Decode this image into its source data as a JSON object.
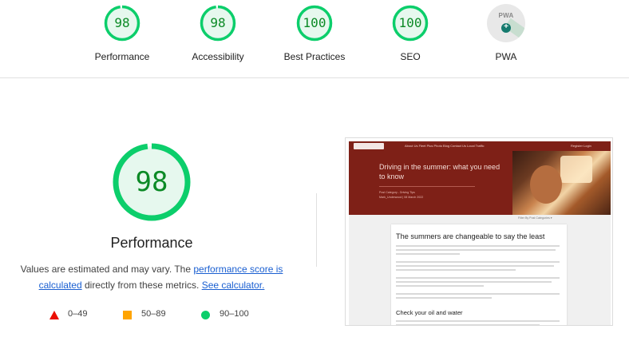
{
  "gauges": [
    {
      "label": "Performance",
      "score": "98",
      "fraction": 0.98
    },
    {
      "label": "Accessibility",
      "score": "98",
      "fraction": 0.98
    },
    {
      "label": "Best Practices",
      "score": "100",
      "fraction": 1.0
    },
    {
      "label": "SEO",
      "score": "100",
      "fraction": 1.0
    }
  ],
  "pwa": {
    "label": "PWA",
    "badge_text": "PWA",
    "icon": "pwa-badge-icon"
  },
  "performance": {
    "score": "98",
    "fraction": 0.98,
    "title": "Performance",
    "desc_prefix": "Values are estimated and may vary. The ",
    "desc_link1": "performance score is calculated",
    "desc_middle": " directly from these metrics. ",
    "desc_link2": "See calculator."
  },
  "legend": [
    {
      "shape": "triangle",
      "range": "0–49",
      "color": "#eb0f00"
    },
    {
      "shape": "square",
      "range": "50–89",
      "color": "#ffa400"
    },
    {
      "shape": "circle",
      "range": "90–100",
      "color": "#0cce6b"
    }
  ],
  "colors": {
    "pass_green": "#0c8a26",
    "pass_ring": "#0cce6b",
    "pass_fill": "#e6f8ee",
    "site_brand": "#7e2017"
  },
  "thumbnail": {
    "nav_links": "About Us    Fleet Plus    Photo    Blog    Contact Us    Local Traffic",
    "nav_right": "Register      Login",
    "hero_title": "Driving in the summer: what you need to know",
    "hero_meta1": "Post Category - Driving Tips",
    "hero_meta2": "Mark_Underwood | 08 March 2022",
    "filter": "Filter By Post Categories ▾",
    "heading1": "The summers are changeable to say the least",
    "heading2": "Check your oil and water"
  }
}
